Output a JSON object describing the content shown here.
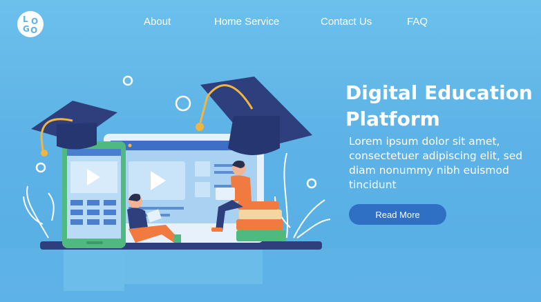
{
  "logo": {
    "letters": [
      "L",
      "O",
      "G",
      "O"
    ]
  },
  "nav": {
    "items": [
      "About",
      "Home  Service",
      "Contact Us",
      "FAQ"
    ]
  },
  "hero": {
    "title_line1": "Digital Education",
    "title_line2": "Platform",
    "description": "Lorem ipsum dolor sit amet, consectetuer adipiscing elit, sed diam nonummy nibh euismod tincidunt",
    "button_label": "Read More"
  },
  "colors": {
    "background": "#5db3e6",
    "accent_dark_blue": "#2f6fc4",
    "cap_navy": "#2d3f7d",
    "tassel_gold": "#f2b640",
    "phone_green": "#4fb980",
    "person_orange": "#f07a3f"
  },
  "icons": [
    "logo-icon",
    "graduation-cap-icon",
    "play-icon",
    "book-stack-icon",
    "plant-icon"
  ]
}
